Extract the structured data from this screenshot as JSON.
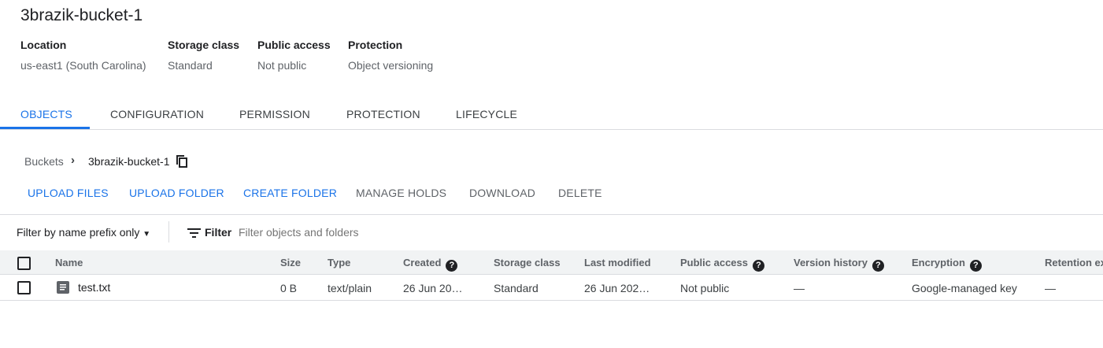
{
  "title": "3brazik-bucket-1",
  "meta": [
    {
      "label": "Location",
      "value": "us-east1 (South Carolina)"
    },
    {
      "label": "Storage class",
      "value": "Standard"
    },
    {
      "label": "Public access",
      "value": "Not public"
    },
    {
      "label": "Protection",
      "value": "Object versioning"
    }
  ],
  "tabs": [
    "OBJECTS",
    "CONFIGURATION",
    "PERMISSION",
    "PROTECTION",
    "LIFECYCLE"
  ],
  "breadcrumb": {
    "root": "Buckets",
    "current": "3brazik-bucket-1"
  },
  "actions": [
    "UPLOAD FILES",
    "UPLOAD FOLDER",
    "CREATE FOLDER",
    "MANAGE HOLDS",
    "DOWNLOAD",
    "DELETE"
  ],
  "filter": {
    "mode": "Filter by name prefix only",
    "label": "Filter",
    "placeholder": "Filter objects and folders"
  },
  "columns": [
    "Name",
    "Size",
    "Type",
    "Created",
    "Storage class",
    "Last modified",
    "Public access",
    "Version history",
    "Encryption",
    "Retention ex"
  ],
  "rows": [
    {
      "name": "test.txt",
      "size": "0 B",
      "type": "text/plain",
      "created": "26 Jun 20…",
      "storage": "Standard",
      "modified": "26 Jun 202…",
      "public": "Not public",
      "version": "—",
      "encryption": "Google-managed key",
      "retention": "—"
    }
  ]
}
